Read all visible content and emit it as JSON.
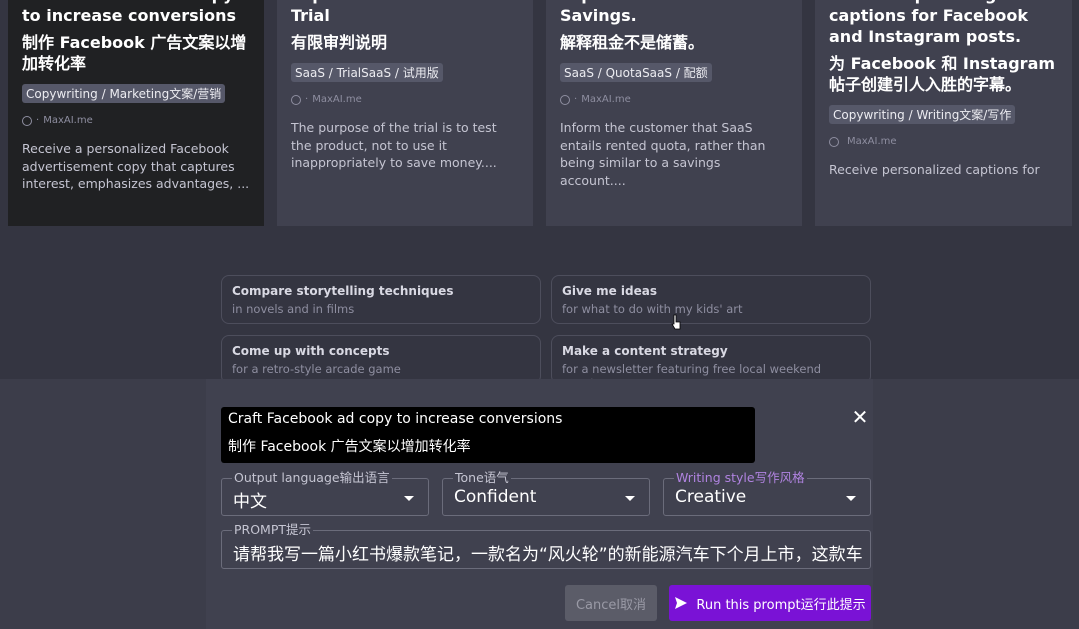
{
  "cards": [
    {
      "title_en": "Craft Facebook ad copy to increase conversions",
      "title_zh": "制作 Facebook 广告文案以增加转化率",
      "tags": "Copywriting / Marketing文案/营销",
      "author": "MaxAI.me",
      "description": "Receive a personalized Facebook advertisement copy that captures interest, emphasizes advantages, ..."
    },
    {
      "title_en": "Explanation of Limited Trial",
      "title_zh": "有限审判说明",
      "tags": "SaaS / TrialSaaS / 试用版",
      "author": "MaxAI.me",
      "description": "The purpose of the trial is to test the product, not to use it inappropriately to save money...."
    },
    {
      "title_en": "Explain Rent is not Savings.",
      "title_zh": "解释租金不是储蓄。",
      "tags": "SaaS / QuotaSaaS / 配额",
      "author": "MaxAI.me",
      "description": "Inform the customer that SaaS entails rented quota, rather than being similar to a savings account...."
    },
    {
      "title_en": "Create captivating captions for Facebook and Instagram posts.",
      "title_zh": "为 Facebook 和 Instagram 帖子创建引人入胜的字幕。",
      "tags": "Copywriting / Writing文案/写作",
      "author": "MaxAI.me",
      "description": "Receive personalized captions for"
    }
  ],
  "suggestions": [
    {
      "title": "Compare storytelling techniques",
      "subtitle": "in novels and in films"
    },
    {
      "title": "Give me ideas",
      "subtitle": "for what to do with my kids' art"
    },
    {
      "title": "Come up with concepts",
      "subtitle": "for a retro-style arcade game"
    },
    {
      "title": "Make a content strategy",
      "subtitle": "for a newsletter featuring free local weekend events"
    }
  ],
  "dialog": {
    "tooltip_en": "Craft Facebook ad copy to increase conversions",
    "tooltip_zh": "制作 Facebook 广告文案以增加转化率",
    "close_glyph": "✕",
    "output_language": {
      "label": "Output language输出语言",
      "value": "中文"
    },
    "tone": {
      "label": "Tone语气",
      "value": "Confident"
    },
    "writing_style": {
      "label": "Writing style写作风格",
      "value": "Creative"
    },
    "prompt": {
      "label": "PROMPT提示",
      "value": "请帮我写一篇小红书爆款笔记，一款名为“风火轮”的新能源汽车下个月上市，这款车"
    },
    "cancel_label": "Cancel取消",
    "run_label": "Run this prompt运行此提示"
  },
  "colors": {
    "accent": "#7a12d6",
    "background": "#343541",
    "card_active": "#202123"
  },
  "icons": {
    "globe": "globe-icon",
    "send": "send-icon",
    "close": "close-icon",
    "caret": "chevron-down-icon"
  }
}
